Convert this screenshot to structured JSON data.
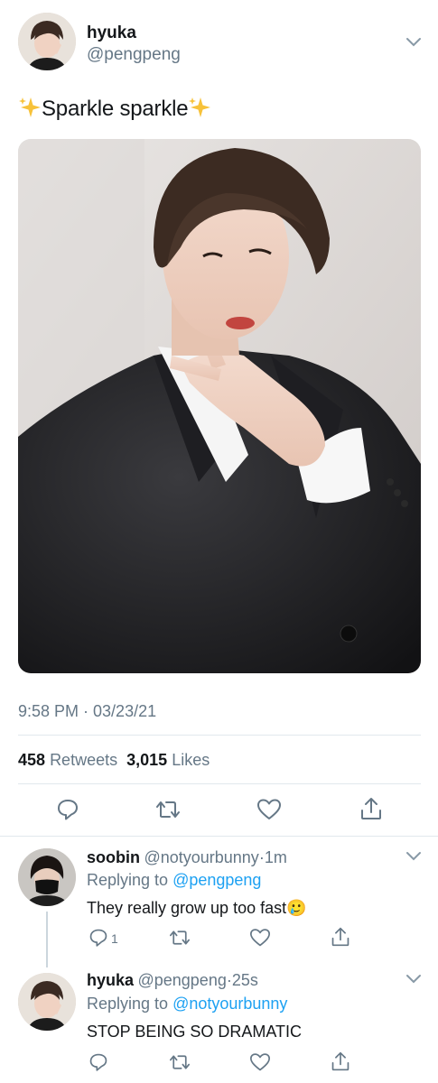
{
  "tweet": {
    "author_name": "hyuka",
    "author_handle": "@pengpeng",
    "text": "Sparkle sparkle",
    "sparkle_emoji": "✨",
    "timestamp": "9:58 PM · 03/23/21",
    "retweets_count": "458",
    "retweets_label": "Retweets",
    "likes_count": "3,015",
    "likes_label": "Likes",
    "actions": [
      "reply-icon",
      "retweet-icon",
      "like-icon",
      "share-icon"
    ]
  },
  "replies": [
    {
      "name": "soobin",
      "handle": "@notyourbunny",
      "separator": "·",
      "time": "1m",
      "replying_prefix": "Replying to",
      "replying_to": "@pengpeng",
      "text": "They really grow up too fast",
      "emoji": "🥲",
      "reply_count": "1"
    },
    {
      "name": "hyuka",
      "handle": "@pengpeng",
      "separator": "·",
      "time": "25s",
      "replying_prefix": "Replying to",
      "replying_to": "@notyourbunny",
      "text": "STOP BEING SO DRAMATIC"
    }
  ],
  "colors": {
    "accent": "#1da1f2",
    "text": "#14171a",
    "muted": "#657786",
    "divider": "#e1e8ed"
  }
}
